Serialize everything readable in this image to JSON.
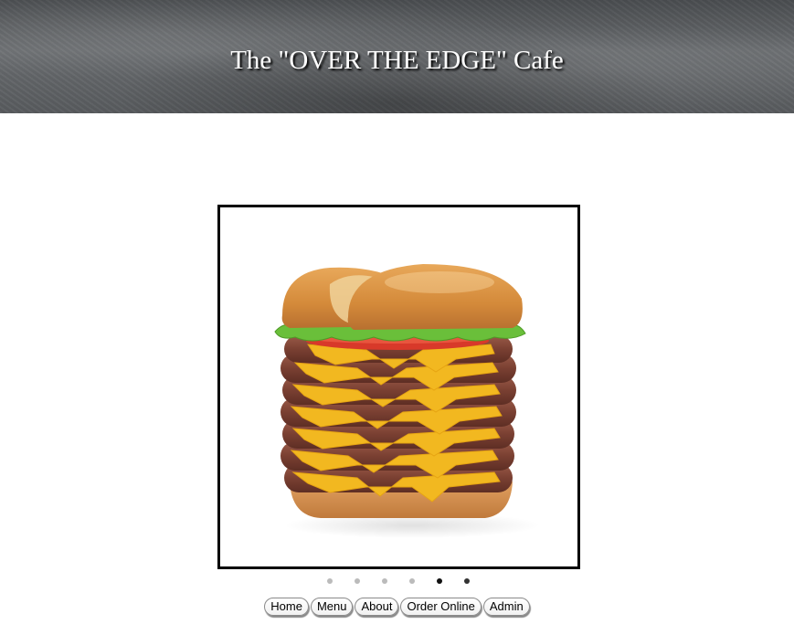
{
  "header": {
    "title": "The \"OVER THE EDGE\" Cafe"
  },
  "slideshow": {
    "image": "stacked-cheeseburger-image",
    "slide_count": 6,
    "active_index": 4
  },
  "nav": {
    "items": [
      {
        "label": "Home"
      },
      {
        "label": "Menu"
      },
      {
        "label": "About"
      },
      {
        "label": "Order Online"
      },
      {
        "label": "Admin"
      }
    ]
  },
  "colors": {
    "header_text": "#ffffff",
    "frame_border": "#000000",
    "dot_inactive": "#bbbbbb",
    "dot_active": "#111111"
  }
}
